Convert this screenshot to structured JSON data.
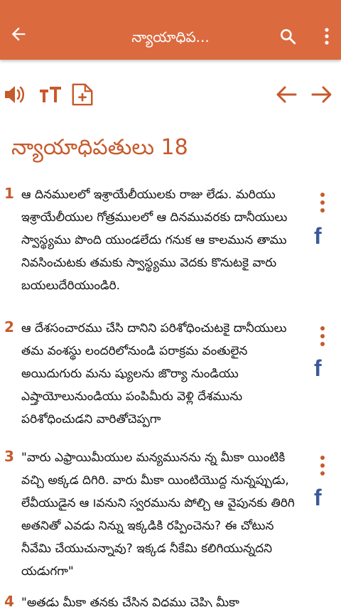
{
  "appbar": {
    "title": "న్యాయాధిప...",
    "back_icon": "arrow-left-icon",
    "search_icon": "search-icon",
    "more_icon": "more-vertical-icon",
    "color": "#dc6a3f"
  },
  "toolbar": {
    "audio_icon": "speaker-icon",
    "font_icon": "text-size-icon",
    "note_icon": "add-note-icon",
    "prev_icon": "arrow-left-icon",
    "next_icon": "arrow-right-icon",
    "accent": "#c65a2c"
  },
  "chapter": {
    "title": "న్యాయాధిపతులు 18"
  },
  "verses": [
    {
      "num": "1",
      "text": "ఆ దినములలో ఇశ్రాయేలీయులకు రాజు లేడు. మరియు ఇశ్రాయేలీయుల గోత్రములలో ఆ దినమువరకు దానీయులు స్వాస్థ్యము పొంది యుండలేదు గనుక ఆ కాలమున తాము నివసించుటకు తమకు స్వాస్థ్యము వెదకు కొనుటకై వారు బయలుదేరియుండిరి."
    },
    {
      "num": "2",
      "text": "ఆ దేశసంచారము చేసి దానిని పరిశోధించుటకై దానీయులు తమ వంశస్థు లందరిలోనుండి పరాక్రమ వంతులైన అయిదుగురు మను ష్యులను జొర్యా నుండియు ఎష్తాయోలునుండియు పంపిమీరు వెళ్లి దేశమును పరిశోధించుడని వారితోచెప్పగా"
    },
    {
      "num": "3",
      "text": "\"వారు ఎఫ్రాయిమీయుల మన్యమునను న్న మీకా యింటికి వచ్చి అక్కడ దిగిరి. వారు మీకా యింటియొద్ద నున్నప్పుడు, లేవీయుడైన ఆ ౹వనుని స్వరమును పోల్చి ఆ వైపునకు తిరిగి అతనితో ఎవడు నిన్ను ఇక్కడికి రప్పించెను? ఈ చోటున నీవేమి చేయుచున్నావు? ఇక్కడ నీకేమి కలిగియున్నదని యడుగగా\""
    },
    {
      "num": "4",
      "text": "\"అతడు మీకా తనకు చేసిన విధము చెప్పి మీకా"
    }
  ]
}
